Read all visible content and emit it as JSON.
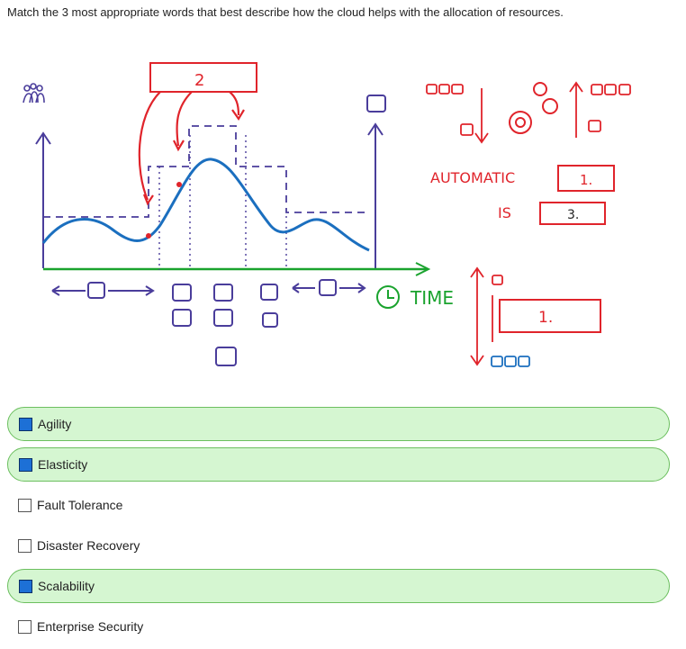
{
  "question": "Match the 3 most appropriate words that best describe how the cloud helps with the allocation of resources.",
  "figure": {
    "label_2": "2",
    "automatic": "AUTOMATIC",
    "is": "IS",
    "box_1": "1.",
    "box_3": "3.",
    "time": "TIME",
    "box_1b": "1."
  },
  "colors": {
    "red": "#e0242b",
    "blue": "#1b6fbf",
    "green": "#1aa32e",
    "purple": "#4a3d9b",
    "selected_bg": "#d5f6d1",
    "checked": "#1d70d6"
  },
  "options": [
    {
      "label": "Agility",
      "checked": true
    },
    {
      "label": "Elasticity",
      "checked": true
    },
    {
      "label": "Fault Tolerance",
      "checked": false
    },
    {
      "label": "Disaster Recovery",
      "checked": false
    },
    {
      "label": "Scalability",
      "checked": true
    },
    {
      "label": "Enterprise Security",
      "checked": false
    }
  ]
}
